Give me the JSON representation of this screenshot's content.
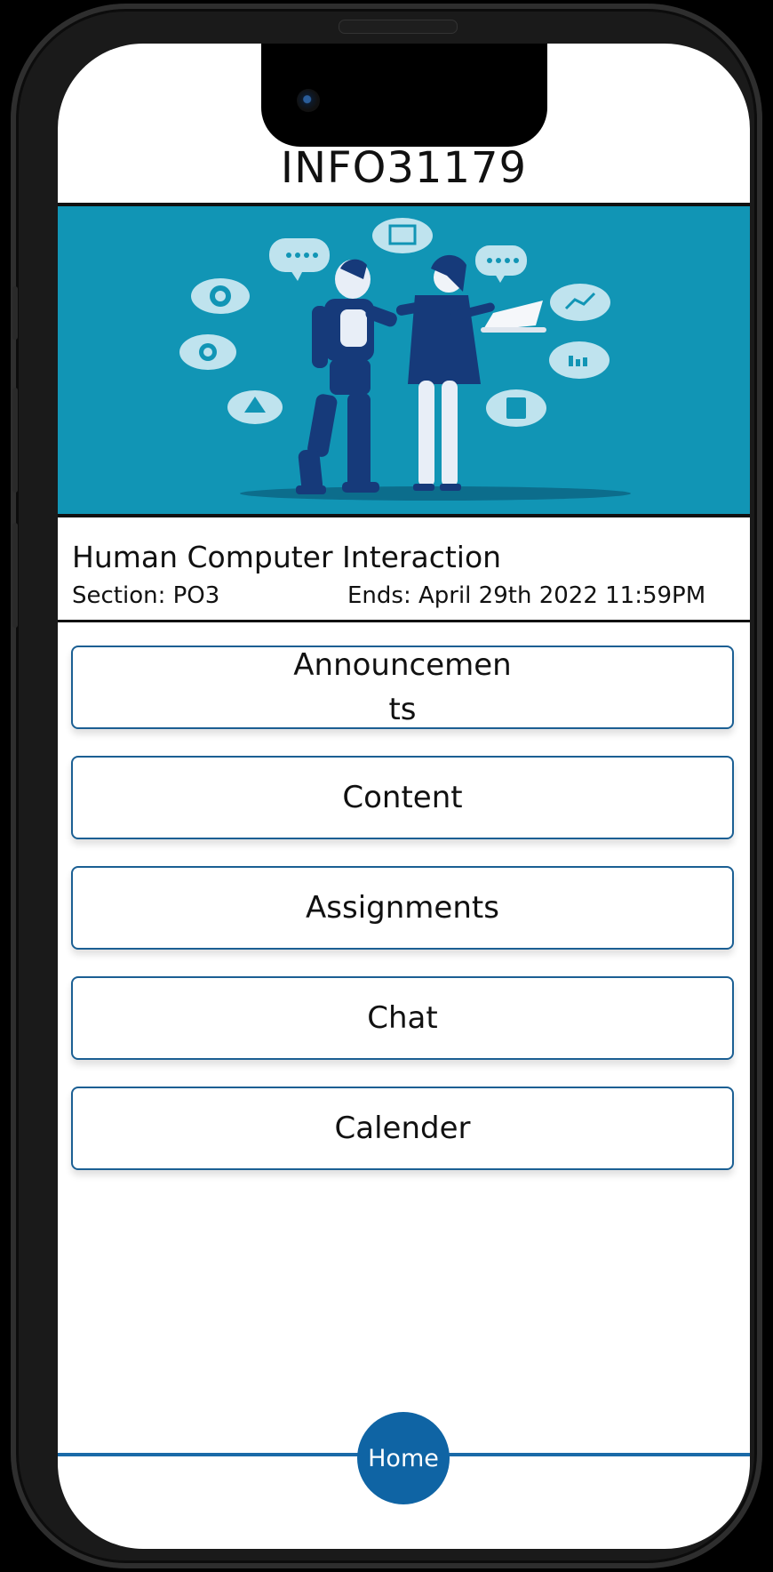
{
  "header": {
    "course_code": "INFO31179"
  },
  "banner": {
    "image": "robot-and-woman-with-laptop-illustration"
  },
  "course": {
    "name": "Human Computer Interaction",
    "section": "Section: PO3",
    "ends": "Ends: April 29th 2022 11:59PM"
  },
  "menu": {
    "items": [
      {
        "label": "Announcements"
      },
      {
        "label": "Content"
      },
      {
        "label": "Assignments"
      },
      {
        "label": "Chat"
      },
      {
        "label": "Calender"
      }
    ]
  },
  "footer": {
    "home_label": "Home"
  },
  "colors": {
    "banner": "#1195b5",
    "accent": "#1b5f93",
    "home": "#0f64a4"
  }
}
